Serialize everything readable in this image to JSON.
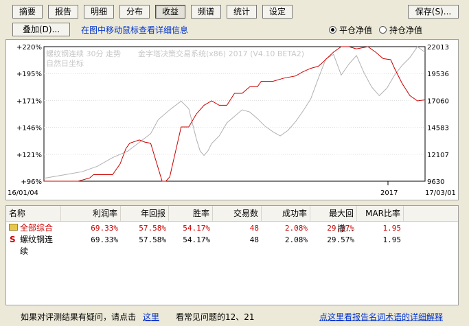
{
  "toolbar": {
    "tabs": [
      {
        "label": "摘要",
        "active": false
      },
      {
        "label": "报告",
        "active": false
      },
      {
        "label": "明细",
        "active": false
      },
      {
        "label": "分布",
        "active": false
      },
      {
        "label": "收益",
        "active": true
      },
      {
        "label": "频谱",
        "active": false
      },
      {
        "label": "统计",
        "active": false
      },
      {
        "label": "设定",
        "active": false
      }
    ],
    "save_label": "保存(S)...",
    "overlay_label": "叠加(D)...",
    "hint_link": "在图中移动鼠标查看详细信息",
    "radio_flat": "平仓净值",
    "radio_hold": "持仓净值",
    "selected_radio": "flat"
  },
  "chart_data": {
    "type": "line",
    "overlay_line1": "螺纹钢连续 30分 走势",
    "overlay_line1_extra": "金字塔决策交易系统(x86) 2017 (V4.10 BETA2)",
    "overlay_line2": "自然日坐标",
    "x_start_label": "16/01/04",
    "x_mid_label": "2017",
    "x_end_label": "17/03/01",
    "left_axis": {
      "labels": [
        "+220%",
        "+195%",
        "+171%",
        "+146%",
        "+121%",
        "+96%"
      ],
      "range": [
        96,
        220
      ]
    },
    "right_axis": {
      "labels": [
        "22013",
        "19536",
        "17060",
        "14583",
        "12107",
        "9630"
      ],
      "range": [
        9630,
        22013
      ]
    },
    "equity_series": {
      "color": "#cc0000",
      "x": [
        0,
        0.09,
        0.12,
        0.13,
        0.18,
        0.2,
        0.215,
        0.225,
        0.25,
        0.265,
        0.28,
        0.31,
        0.32,
        0.33,
        0.36,
        0.38,
        0.4,
        0.42,
        0.44,
        0.46,
        0.48,
        0.5,
        0.52,
        0.54,
        0.56,
        0.57,
        0.6,
        0.63,
        0.66,
        0.68,
        0.7,
        0.72,
        0.73,
        0.76,
        0.78,
        0.8,
        0.82,
        0.85,
        0.87,
        0.89,
        0.91,
        0.92,
        0.94,
        0.96,
        0.98,
        1.0
      ],
      "y": [
        96,
        96,
        99,
        102,
        102,
        112,
        126,
        131,
        134,
        132,
        131,
        96,
        96,
        100,
        146,
        146,
        158,
        166,
        170,
        166,
        166,
        177,
        177,
        183,
        183,
        188,
        188,
        191,
        193,
        197,
        200,
        202,
        205,
        215,
        220,
        220,
        218,
        220,
        215,
        209,
        208,
        200,
        186,
        175,
        170,
        171
      ]
    },
    "price_series": {
      "color": "#b0b0b0",
      "x": [
        0,
        0.05,
        0.1,
        0.14,
        0.18,
        0.22,
        0.25,
        0.28,
        0.3,
        0.33,
        0.36,
        0.38,
        0.4,
        0.41,
        0.42,
        0.43,
        0.44,
        0.46,
        0.48,
        0.5,
        0.52,
        0.54,
        0.56,
        0.58,
        0.6,
        0.62,
        0.64,
        0.66,
        0.68,
        0.7,
        0.72,
        0.74,
        0.76,
        0.78,
        0.8,
        0.82,
        0.84,
        0.86,
        0.88,
        0.9,
        0.92,
        0.94,
        0.96,
        0.98,
        1.0
      ],
      "y": [
        9900,
        10200,
        10500,
        11000,
        11800,
        12400,
        13200,
        14000,
        15300,
        16200,
        17000,
        16300,
        13500,
        12400,
        12000,
        12400,
        13100,
        13800,
        15000,
        15600,
        16200,
        16000,
        15400,
        14700,
        14200,
        13800,
        14300,
        15100,
        16100,
        17200,
        19100,
        20900,
        21300,
        19400,
        20400,
        21200,
        19600,
        18300,
        17500,
        18200,
        19400,
        20300,
        21000,
        22013,
        21500
      ]
    }
  },
  "table": {
    "columns": [
      "名称",
      "利润率",
      "年回报",
      "胜率",
      "交易数",
      "成功率",
      "最大回撤...",
      "MAR比率"
    ],
    "rows": [
      {
        "icon": "folder-icon",
        "name": "全部综合",
        "values": [
          "69.33%",
          "57.58%",
          "54.17%",
          "48",
          "2.08%",
          "29.57%",
          "1.95"
        ],
        "color": "#cc0000"
      },
      {
        "icon": "s-icon",
        "name": "螺纹钢连续",
        "values": [
          "69.33%",
          "57.58%",
          "54.17%",
          "48",
          "2.08%",
          "29.57%",
          "1.95"
        ],
        "color": "#000000"
      }
    ]
  },
  "footer": {
    "question_text": "如果对评测结果有疑问，请点击",
    "here_link": "这里",
    "faq_text": "看常见问题的12、21",
    "glossary_link": "点这里看报告名词术语的详细解释"
  }
}
